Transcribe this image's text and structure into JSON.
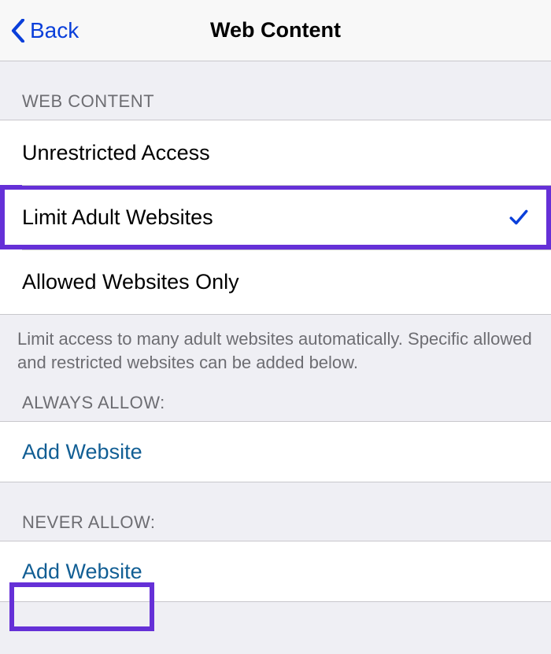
{
  "nav": {
    "back_label": "Back",
    "title": "Web Content"
  },
  "sections": {
    "web_content": {
      "header": "WEB CONTENT",
      "options": [
        {
          "label": "Unrestricted Access",
          "selected": false
        },
        {
          "label": "Limit Adult Websites",
          "selected": true
        },
        {
          "label": "Allowed Websites Only",
          "selected": false
        }
      ],
      "footer": "Limit access to many adult websites automatically. Specific allowed and restricted websites can be added below."
    },
    "always_allow": {
      "header": "ALWAYS ALLOW:",
      "action": "Add Website"
    },
    "never_allow": {
      "header": "NEVER ALLOW:",
      "action": "Add Website"
    }
  }
}
